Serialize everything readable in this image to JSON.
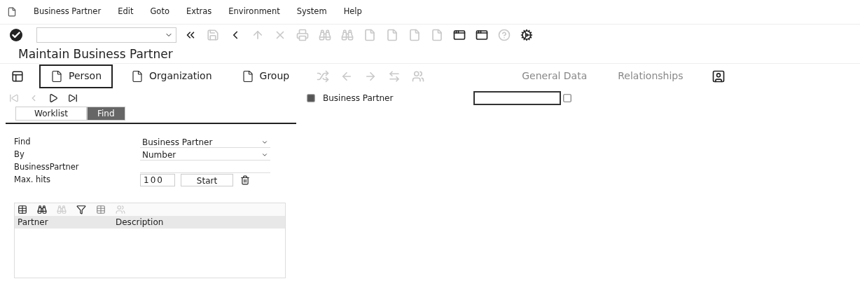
{
  "menu_bar": {
    "items": [
      "Business Partner",
      "Edit",
      "Goto",
      "Extras",
      "Environment",
      "System",
      "Help"
    ]
  },
  "toolbar": {
    "buttons": [
      {
        "kind": "back",
        "disabled": false
      },
      {
        "kind": "save",
        "disabled": true
      },
      {
        "kind": "back-circle",
        "disabled": false
      },
      {
        "kind": "exit",
        "disabled": true
      },
      {
        "kind": "cancel",
        "disabled": true
      },
      {
        "kind": "print",
        "disabled": true
      },
      {
        "kind": "find",
        "disabled": true
      },
      {
        "kind": "find-next",
        "disabled": true
      },
      {
        "kind": "page",
        "disabled": true
      },
      {
        "kind": "page",
        "disabled": true
      },
      {
        "kind": "page",
        "disabled": true
      },
      {
        "kind": "page",
        "disabled": true
      },
      {
        "kind": "window",
        "disabled": false
      },
      {
        "kind": "window",
        "disabled": false
      },
      {
        "kind": "help",
        "disabled": true
      },
      {
        "kind": "settings",
        "disabled": false
      }
    ]
  },
  "title": "Maintain Business Partner",
  "app_toolbar": {
    "create_buttons": [
      {
        "label": "Person",
        "selected": true
      },
      {
        "label": "Organization",
        "selected": false
      },
      {
        "label": "Group",
        "selected": false
      }
    ],
    "tools": [
      {
        "kind": "switch",
        "disabled": true
      },
      {
        "kind": "left",
        "disabled": true
      },
      {
        "kind": "right",
        "disabled": true
      },
      {
        "kind": "swap",
        "disabled": true
      },
      {
        "kind": "people",
        "disabled": true
      }
    ],
    "tabs": [
      {
        "label": "General Data",
        "disabled": true
      },
      {
        "label": "Relationships",
        "disabled": true
      }
    ]
  },
  "locator": {
    "nav": [
      {
        "kind": "first",
        "disabled": true
      },
      {
        "kind": "prev",
        "disabled": true
      },
      {
        "kind": "next",
        "disabled": false
      },
      {
        "kind": "last",
        "disabled": false
      }
    ],
    "tabs": [
      {
        "label": "Worklist",
        "selected": false
      },
      {
        "label": "Find",
        "selected": true
      }
    ],
    "form": [
      {
        "label": "Find",
        "value": "Business Partner",
        "kind": "dropdown"
      },
      {
        "label": "By",
        "value": "Number",
        "kind": "dropdown"
      },
      {
        "label": "BusinessPartner",
        "kind": "text"
      },
      {
        "label": "Max. hits",
        "value": "100",
        "kind": "hits",
        "button": "Start"
      }
    ],
    "grid": {
      "columns": [
        "Partner",
        "Description"
      ]
    }
  },
  "detail": {
    "label": "Business Partner"
  }
}
